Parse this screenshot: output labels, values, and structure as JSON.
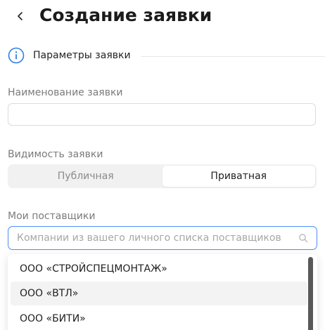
{
  "header": {
    "title": "Создание заявки",
    "back_icon": "chevron-left-icon"
  },
  "section": {
    "icon": "info-icon",
    "label": "Параметры заявки",
    "accent_color": "#2f7fe0"
  },
  "fields": {
    "name": {
      "label": "Наименование заявки",
      "value": "",
      "placeholder": ""
    },
    "visibility": {
      "label": "Видимость заявки",
      "options": [
        "Публичная",
        "Приватная"
      ],
      "selected": "Приватная"
    },
    "suppliers": {
      "label": "Мои поставщики",
      "value": "",
      "placeholder": "Компании из вашего личного списка поставщиков",
      "focus_color": "#4b8df8",
      "options": [
        "ООО «СТРОЙСПЕЦМОНТАЖ»",
        "ООО «ВТЛ»",
        "ООО «БИТИ»"
      ],
      "hovered": "ООО «ВТЛ»"
    }
  }
}
